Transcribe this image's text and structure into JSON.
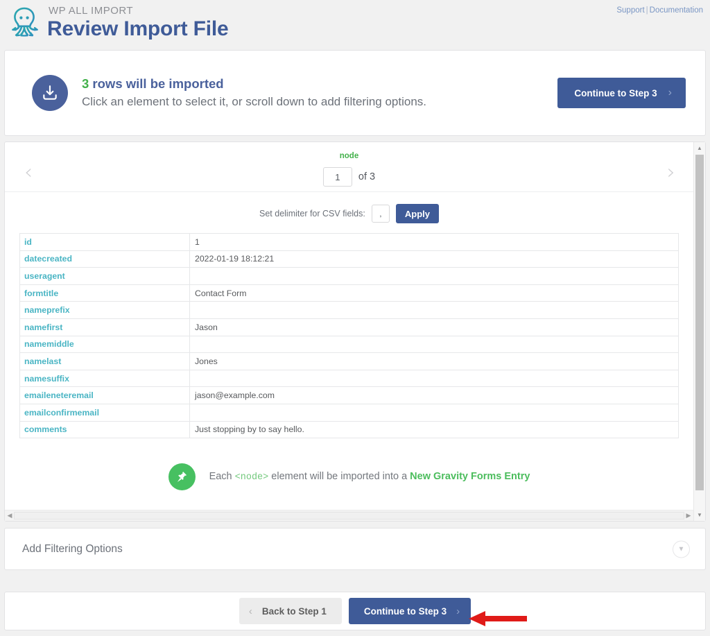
{
  "header": {
    "brand": "WP ALL IMPORT",
    "title": "Review Import File",
    "logo_icon": "octopus-logo",
    "links": {
      "support": "Support",
      "separator": "|",
      "documentation": "Documentation"
    }
  },
  "notice": {
    "icon": "import-download-icon",
    "count": "3",
    "headline_rest": " rows will be imported",
    "subtext": "Click an element to select it, or scroll down to add filtering options.",
    "button_label": "Continue to Step 3",
    "button_chevron": "chevron-right-icon",
    "accent_green": "#43b14b",
    "accent_blue": "#3f5b98"
  },
  "preview": {
    "node_label": "node",
    "prev_icon": "chevron-left-icon",
    "next_icon": "chevron-right-icon",
    "current_index": "1",
    "of_label": "of 3",
    "delimiter_label": "Set delimiter for CSV fields:",
    "delimiter_value": ",",
    "apply_label": "Apply",
    "rows": [
      {
        "field": "id",
        "value": "1"
      },
      {
        "field": "datecreated",
        "value": "2022-01-19 18:12:21"
      },
      {
        "field": "useragent",
        "value": ""
      },
      {
        "field": "formtitle",
        "value": "Contact Form"
      },
      {
        "field": "nameprefix",
        "value": ""
      },
      {
        "field": "namefirst",
        "value": "Jason"
      },
      {
        "field": "namemiddle",
        "value": ""
      },
      {
        "field": "namelast",
        "value": "Jones"
      },
      {
        "field": "namesuffix",
        "value": ""
      },
      {
        "field": "emaileneteremail",
        "value": "jason@example.com"
      },
      {
        "field": "emailconfirmemail",
        "value": ""
      },
      {
        "field": "comments",
        "value": "Just stopping by to say hello."
      }
    ],
    "note": {
      "icon": "green-pin-icon",
      "prefix": "Each ",
      "tag": "<node>",
      "middle": " element will be imported into a ",
      "target": "New Gravity Forms Entry"
    },
    "field_color": "#4ab5c4"
  },
  "filtering": {
    "title": "Add Filtering Options",
    "chevron_icon": "chevron-down-icon"
  },
  "footer": {
    "back_label": "Back to Step 1",
    "back_chevron": "chevron-left-icon",
    "continue_label": "Continue to Step 3",
    "continue_chevron": "chevron-right-icon",
    "annotation_icon": "red-arrow-annotation",
    "annotation_color": "#e01b18"
  }
}
